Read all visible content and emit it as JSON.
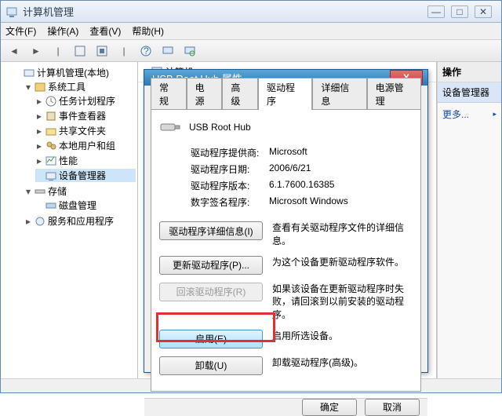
{
  "window": {
    "title": "计算机管理"
  },
  "menu": {
    "file": "文件(F)",
    "action": "操作(A)",
    "view": "查看(V)",
    "help": "帮助(H)"
  },
  "tree": {
    "root": "计算机管理(本地)",
    "systools": "系统工具",
    "scheduler": "任务计划程序",
    "eventviewer": "事件查看器",
    "shared": "共享文件夹",
    "users": "本地用户和组",
    "perf": "性能",
    "devmgr": "设备管理器",
    "storage": "存储",
    "diskmgmt": "磁盘管理",
    "services": "服务和应用程序"
  },
  "mid": {
    "computer": "计算机"
  },
  "right": {
    "header": "操作",
    "section": "设备管理器",
    "more": "更多..."
  },
  "dialog": {
    "title": "USB Root Hub 属性",
    "tabs": {
      "general": "常规",
      "power": "电源",
      "advanced": "高级",
      "driver": "驱动程序",
      "details": "详细信息",
      "powermgmt": "电源管理"
    },
    "device_name": "USB Root Hub",
    "rows": {
      "provider_label": "驱动程序提供商:",
      "provider_value": "Microsoft",
      "date_label": "驱动程序日期:",
      "date_value": "2006/6/21",
      "version_label": "驱动程序版本:",
      "version_value": "6.1.7600.16385",
      "signer_label": "数字签名程序:",
      "signer_value": "Microsoft Windows"
    },
    "buttons": {
      "details": "驱动程序详细信息(I)",
      "details_desc": "查看有关驱动程序文件的详细信息。",
      "update": "更新驱动程序(P)...",
      "update_desc": "为这个设备更新驱动程序软件。",
      "rollback": "回滚驱动程序(R)",
      "rollback_desc": "如果该设备在更新驱动程序时失败，请回滚到以前安装的驱动程序。",
      "enable": "启用(E)",
      "enable_desc": "启用所选设备。",
      "uninstall": "卸载(U)",
      "uninstall_desc": "卸载驱动程序(高级)。"
    },
    "ok": "确定",
    "cancel": "取消"
  }
}
